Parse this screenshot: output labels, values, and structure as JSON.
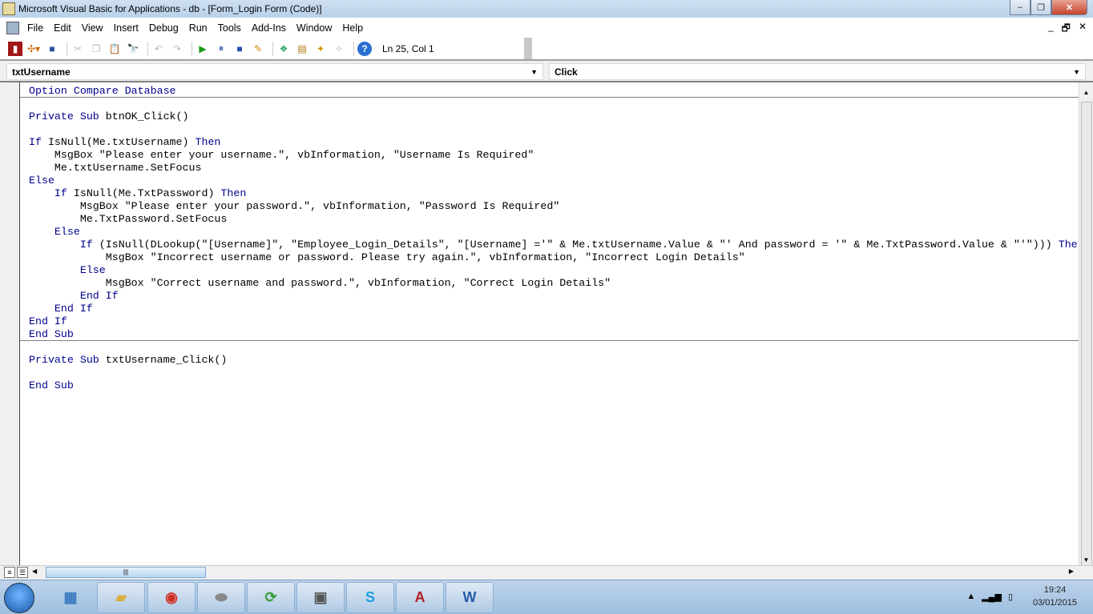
{
  "window": {
    "title": "Microsoft Visual Basic for Applications - db - [Form_Login Form (Code)]",
    "min": "‒",
    "max": "❐",
    "close": "✕"
  },
  "menu": [
    "File",
    "Edit",
    "View",
    "Insert",
    "Debug",
    "Run",
    "Tools",
    "Add-Ins",
    "Window",
    "Help"
  ],
  "mdi": {
    "min": "_",
    "restore": "🗗",
    "close": "✕"
  },
  "toolbar": {
    "position": "Ln 25, Col 1",
    "icons": [
      "access-icon",
      "insert-icon",
      "save-icon",
      "cut-icon",
      "copy-icon",
      "paste-icon",
      "find-icon",
      "undo-icon",
      "redo-icon",
      "run-icon",
      "break-icon",
      "reset-icon",
      "design-mode-icon",
      "project-explorer-icon",
      "properties-icon",
      "object-browser-icon",
      "toolbox-icon",
      "help-icon"
    ]
  },
  "combos": {
    "object": "txtUsername",
    "procedure": "Click"
  },
  "code": [
    [
      [
        "Option Compare Database",
        1
      ]
    ],
    [],
    [
      [
        "Private Sub",
        1
      ],
      [
        " btnOK_Click()",
        0
      ]
    ],
    [],
    [
      [
        "If",
        1
      ],
      [
        " IsNull(Me.txtUsername) ",
        0
      ],
      [
        "Then",
        1
      ]
    ],
    [
      [
        "    MsgBox \"Please enter your username.\", vbInformation, \"Username Is Required\"",
        0
      ]
    ],
    [
      [
        "    Me.txtUsername.SetFocus",
        0
      ]
    ],
    [
      [
        "Else",
        1
      ]
    ],
    [
      [
        "    ",
        0
      ],
      [
        "If",
        1
      ],
      [
        " IsNull(Me.TxtPassword) ",
        0
      ],
      [
        "Then",
        1
      ]
    ],
    [
      [
        "        MsgBox \"Please enter your password.\", vbInformation, \"Password Is Required\"",
        0
      ]
    ],
    [
      [
        "        Me.TxtPassword.SetFocus",
        0
      ]
    ],
    [
      [
        "    ",
        0
      ],
      [
        "Else",
        1
      ]
    ],
    [
      [
        "        ",
        0
      ],
      [
        "If",
        1
      ],
      [
        " (IsNull(DLookup(\"[Username]\", \"Employee_Login_Details\", \"[Username] ='\" & Me.txtUsername.Value & \"' And password = '\" & Me.TxtPassword.Value & \"'\"))) ",
        0
      ],
      [
        "The",
        1
      ]
    ],
    [
      [
        "            MsgBox \"Incorrect username or password. Please try again.\", vbInformation, \"Incorrect Login Details\"",
        0
      ]
    ],
    [
      [
        "        ",
        0
      ],
      [
        "Else",
        1
      ]
    ],
    [
      [
        "            MsgBox \"Correct username and password.\", vbInformation, \"Correct Login Details\"",
        0
      ]
    ],
    [
      [
        "        ",
        0
      ],
      [
        "End If",
        1
      ]
    ],
    [
      [
        "    ",
        0
      ],
      [
        "End If",
        1
      ]
    ],
    [
      [
        "End If",
        1
      ]
    ],
    [
      [
        "End Sub",
        1
      ]
    ],
    [],
    [
      [
        "Private Sub",
        1
      ],
      [
        " txtUsername_Click()",
        0
      ]
    ],
    [],
    [
      [
        "End Sub",
        1
      ]
    ]
  ],
  "taskbar": {
    "apps": [
      "control-panel",
      "explorer",
      "chrome",
      "drive",
      "sync",
      "media",
      "skype",
      "access",
      "word"
    ],
    "labels": {
      "skype": "S",
      "access": "A",
      "word": "W"
    },
    "time": "19:24",
    "date": "03/01/2015"
  },
  "colors": {
    "keyword": "#00008b"
  }
}
